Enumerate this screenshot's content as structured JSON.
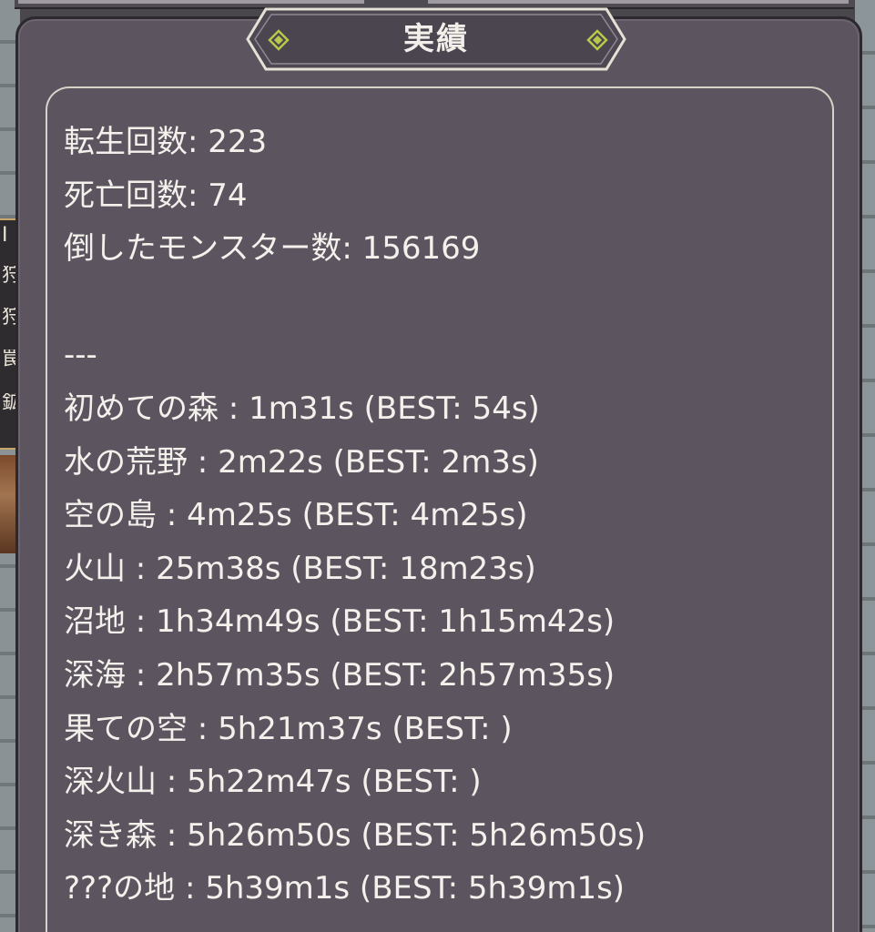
{
  "title": "実績",
  "stats": {
    "lines": [
      "転生回数: 223",
      "死亡回数: 74",
      "倒したモンスター数: 156169"
    ],
    "separator": "---",
    "area_lines": [
      "初めての森 : 1m31s (BEST: 54s)",
      "水の荒野 : 2m22s (BEST: 2m3s)",
      "空の島 : 4m25s (BEST: 4m25s)",
      "火山 : 25m38s (BEST: 18m23s)",
      "沼地 : 1h34m49s (BEST: 1h15m42s)",
      "深海 : 2h57m35s (BEST: 2h57m35s)",
      "果ての空 : 5h21m37s (BEST: )",
      "深火山 : 5h22m47s (BEST: )",
      "深き森 : 5h26m50s (BEST: 5h26m50s)",
      "???の地 : 5h39m1s (BEST: 5h39m1s)"
    ]
  },
  "background": {
    "left_sign_glyphs": [
      "I",
      "狩",
      "狩",
      "罠",
      "鉱"
    ]
  },
  "colors": {
    "panel_bg": "#5c5560",
    "text": "#f4f1ec",
    "tab_gem": "#b7c94a"
  }
}
